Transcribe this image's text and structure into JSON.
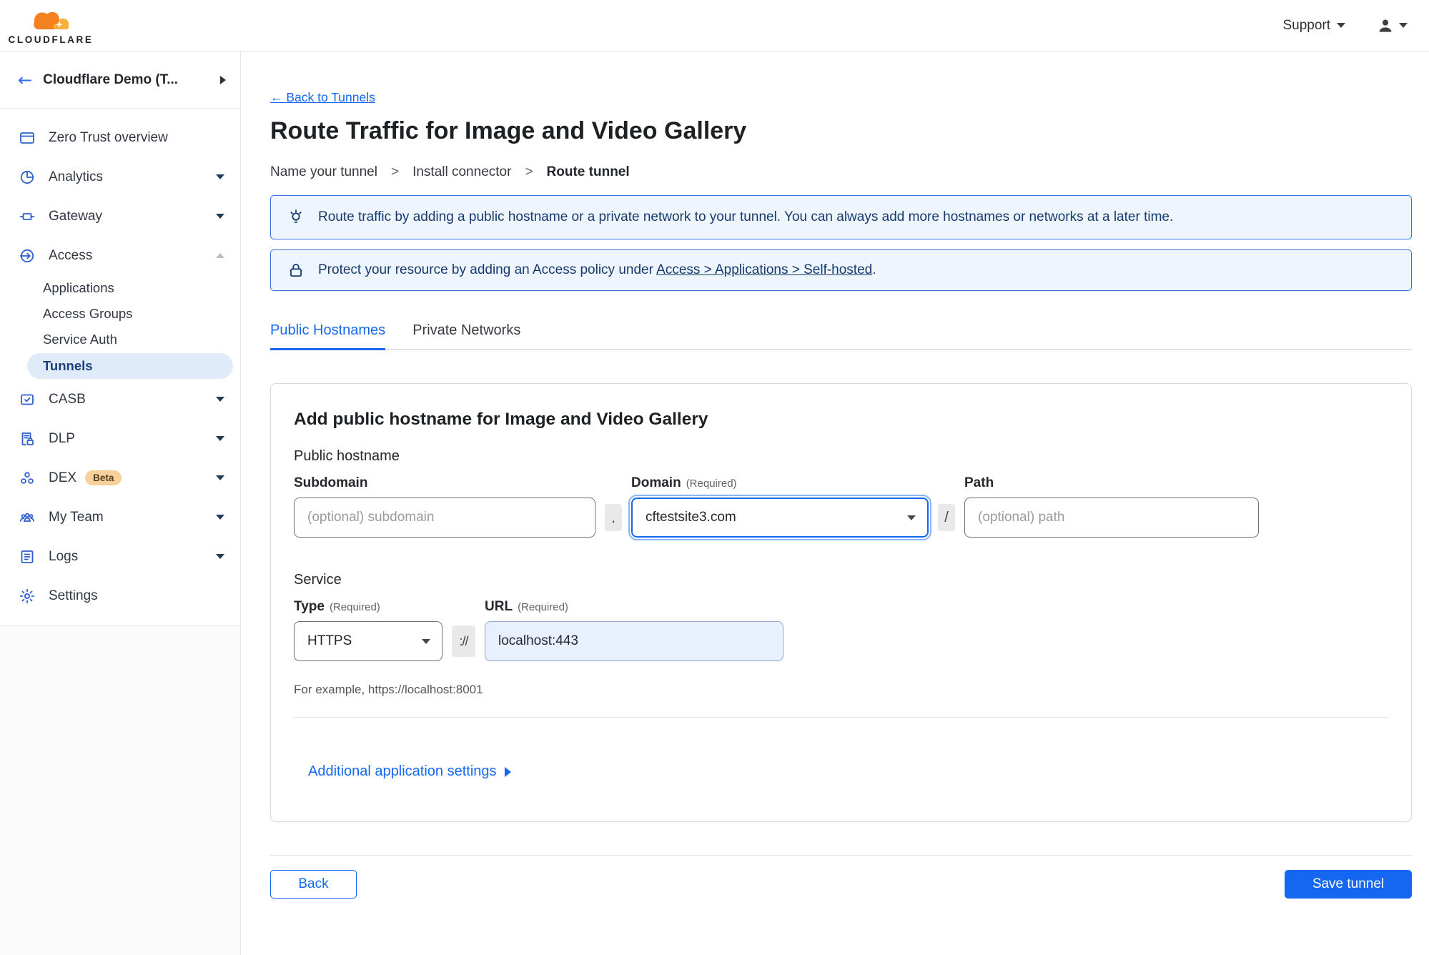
{
  "colors": {
    "accent": "#1567f2",
    "sidebar_icon": "#2e5ed1",
    "banner_bg": "#eef5fd",
    "banner_border": "#3573d9",
    "banner_text": "#173a6d",
    "pill_bg": "#e0ebf9",
    "pill_text": "#1b3f79",
    "url_fill": "#e8f0fe",
    "beta_bg": "#f9cf9b",
    "beta_text": "#53401e"
  },
  "header": {
    "logo_text": "CLOUDFLARE",
    "support_label": "Support"
  },
  "sidebar": {
    "account_label": "Cloudflare Demo (T...",
    "items": [
      {
        "label": "Zero Trust overview"
      },
      {
        "label": "Analytics"
      },
      {
        "label": "Gateway"
      },
      {
        "label": "Access"
      },
      {
        "label": "CASB"
      },
      {
        "label": "DLP"
      },
      {
        "label": "DEX",
        "badge": "Beta"
      },
      {
        "label": "My Team"
      },
      {
        "label": "Logs"
      },
      {
        "label": "Settings"
      }
    ],
    "access_children": [
      {
        "label": "Applications"
      },
      {
        "label": "Access Groups"
      },
      {
        "label": "Service Auth"
      },
      {
        "label": "Tunnels"
      }
    ]
  },
  "main": {
    "back_link": "← Back to Tunnels",
    "title": "Route Traffic for Image and Video Gallery",
    "steps": {
      "s1": "Name your tunnel",
      "s2": "Install connector",
      "s3": "Route tunnel",
      "sep": ">"
    },
    "banner_tip": "Route traffic by adding a public hostname or a private network to your tunnel. You can always add more hostnames or networks at a later time.",
    "banner_lock_before": "Protect your resource by adding an Access policy under ",
    "banner_lock_link": "Access > Applications > Self-hosted",
    "banner_lock_after": ".",
    "tabs": {
      "public": "Public Hostnames",
      "private": "Private Networks"
    },
    "form": {
      "heading": "Add public hostname for Image and Video Gallery",
      "public_hostname_label": "Public hostname",
      "subdomain_label": "Subdomain",
      "subdomain_placeholder": "(optional) subdomain",
      "dot": ".",
      "domain_label": "Domain",
      "required_label": "(Required)",
      "domain_value": "cftestsite3.com",
      "slash": "/",
      "path_label": "Path",
      "path_placeholder": "(optional) path",
      "service_label": "Service",
      "type_label": "Type",
      "type_value": "HTTPS",
      "scheme_separator": "://",
      "url_label": "URL",
      "url_value": "localhost:443",
      "example_text": "For example, https://localhost:8001",
      "additional_settings_label": "Additional application settings"
    }
  },
  "footer": {
    "back_label": "Back",
    "save_label": "Save tunnel"
  }
}
